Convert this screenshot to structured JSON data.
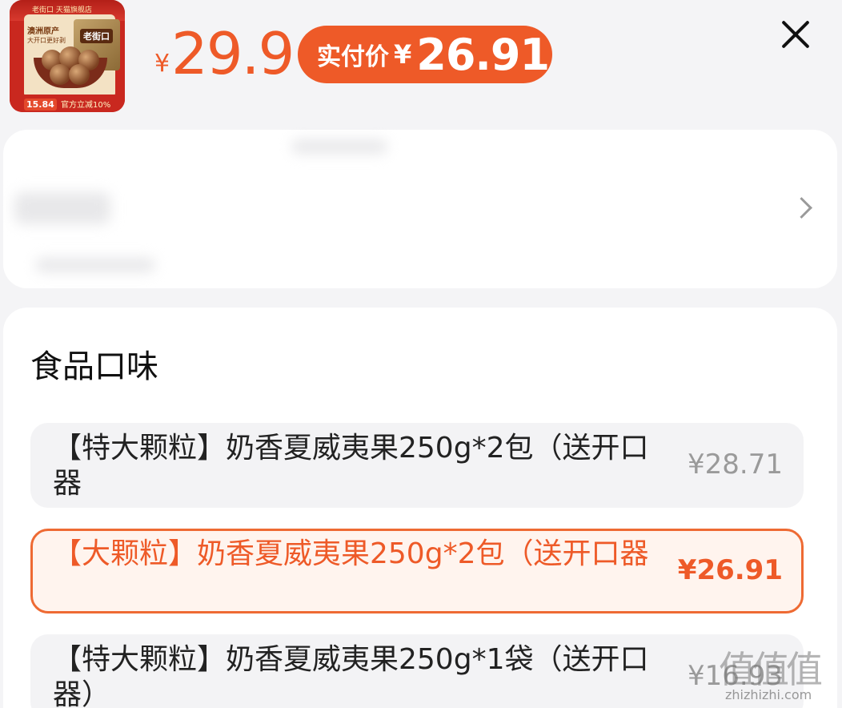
{
  "product": {
    "thumbnail": {
      "strip_text": "老街口 天猫旗舰店",
      "origin": "澳洲原产",
      "tagline": "大开口更好剥",
      "brand": "老街口",
      "price": "15.84",
      "tag": "官方立减10%"
    },
    "currency": "¥",
    "list_price": "29.9",
    "pay_label": "实付价",
    "pay_price": "26.91"
  },
  "close_icon": "close-icon",
  "address_card": {
    "chevron_icon": "chevron-right-icon"
  },
  "flavor": {
    "title": "食品口味",
    "options": [
      {
        "label": "【特大颗粒】奶香夏威夷果250g*2包（送开口器",
        "price": "¥28.71",
        "selected": false
      },
      {
        "label": "【大颗粒】奶香夏威夷果250g*2包（送开口器",
        "price": "¥26.91",
        "selected": true
      },
      {
        "label": "【特大颗粒】奶香夏威夷果250g*1袋（送开口器）",
        "price": "¥16.93",
        "selected": false
      }
    ]
  },
  "watermark": {
    "logo": "值值值",
    "url": "zhizhizhi.com"
  },
  "colors": {
    "accent": "#ee5a28",
    "selected_bg": "#fff4ee",
    "option_bg": "#f3f3f5",
    "page_bg": "#f4f4f6"
  }
}
